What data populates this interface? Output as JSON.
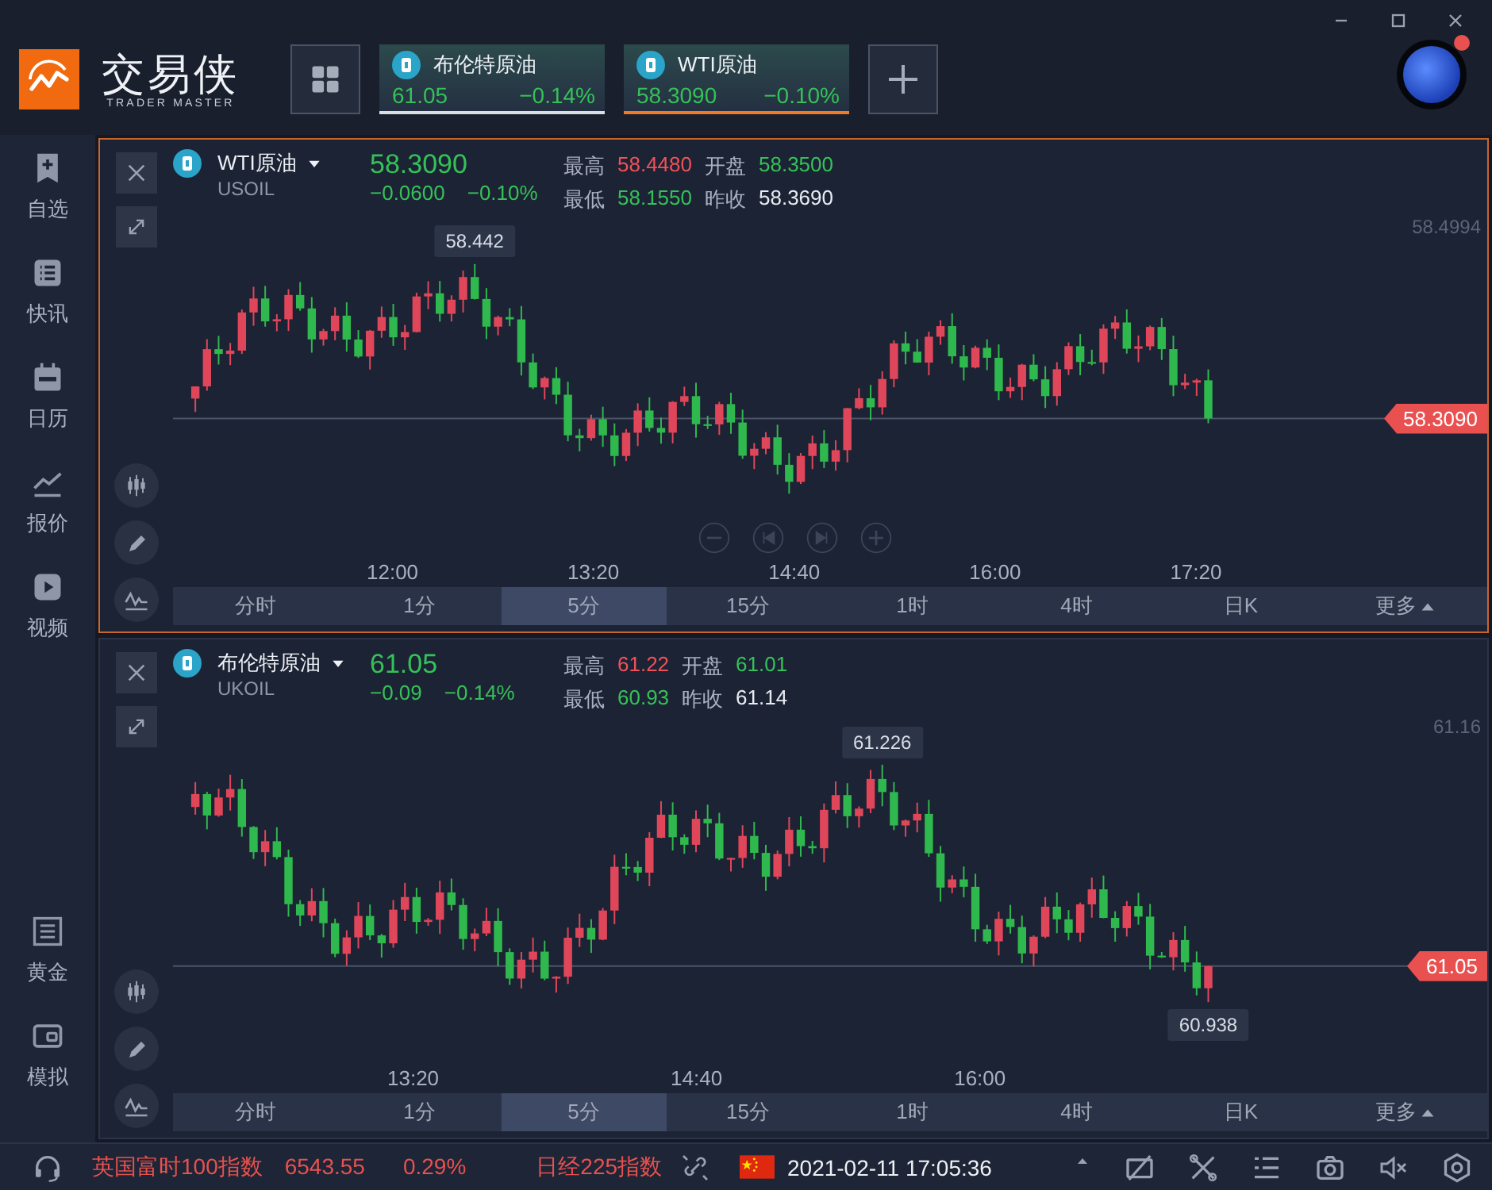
{
  "app": {
    "name": "交易侠",
    "tagline": "TRADER MASTER"
  },
  "quote_tabs": [
    {
      "name": "布伦特原油",
      "price": "61.05",
      "change": "−0.14%",
      "selected": false
    },
    {
      "name": "WTI原油",
      "price": "58.3090",
      "change": "−0.10%",
      "selected": true
    }
  ],
  "sidebar": {
    "items": [
      {
        "label": "自选"
      },
      {
        "label": "快讯"
      },
      {
        "label": "日历"
      },
      {
        "label": "报价"
      },
      {
        "label": "视频"
      }
    ],
    "bottom_items": [
      {
        "label": "黄金"
      },
      {
        "label": "模拟"
      }
    ]
  },
  "charts": [
    {
      "active": true,
      "name": "WTI原油",
      "symbol": "USOIL",
      "price": "58.3090",
      "change": "−0.0600",
      "change_pct": "−0.10%",
      "stats": [
        {
          "label": "最高",
          "value": "58.4480",
          "color": "#f25157"
        },
        {
          "label": "开盘",
          "value": "58.3500",
          "color": "#35c158"
        },
        {
          "label": "最低",
          "value": "58.1550",
          "color": "#35c158"
        },
        {
          "label": "昨收",
          "value": "58.3690",
          "color": "#e8ecf2"
        }
      ],
      "axis_label": "58.4994",
      "high_marker": "58.442",
      "last_tag": "58.3090",
      "times": [
        "12:00",
        "13:20",
        "14:40",
        "16:00",
        "17:20"
      ],
      "periods": [
        {
          "label": "分时",
          "selected": false
        },
        {
          "label": "1分",
          "selected": false
        },
        {
          "label": "5分",
          "selected": true
        },
        {
          "label": "15分",
          "selected": false
        },
        {
          "label": "1时",
          "selected": false
        },
        {
          "label": "4时",
          "selected": false
        },
        {
          "label": "日K",
          "selected": false
        },
        {
          "label": "更多",
          "selected": false
        }
      ]
    },
    {
      "active": false,
      "name": "布伦特原油",
      "symbol": "UKOIL",
      "price": "61.05",
      "change": "−0.09",
      "change_pct": "−0.14%",
      "stats": [
        {
          "label": "最高",
          "value": "61.22",
          "color": "#f25157"
        },
        {
          "label": "开盘",
          "value": "61.01",
          "color": "#35c158"
        },
        {
          "label": "最低",
          "value": "60.93",
          "color": "#35c158"
        },
        {
          "label": "昨收",
          "value": "61.14",
          "color": "#e8ecf2"
        }
      ],
      "axis_label": "61.16",
      "high_marker": "61.226",
      "low_marker": "60.938",
      "last_tag": "61.05",
      "times": [
        "13:20",
        "14:40",
        "16:00"
      ],
      "periods": [
        {
          "label": "分时",
          "selected": false
        },
        {
          "label": "1分",
          "selected": false
        },
        {
          "label": "5分",
          "selected": true
        },
        {
          "label": "15分",
          "selected": false
        },
        {
          "label": "1时",
          "selected": false
        },
        {
          "label": "4时",
          "selected": false
        },
        {
          "label": "日K",
          "selected": false
        },
        {
          "label": "更多",
          "selected": false
        }
      ]
    }
  ],
  "status_bar": {
    "ticker": [
      {
        "name": "英国富时100指数",
        "value": "6543.55",
        "change": "0.29%"
      },
      {
        "name": "日经225指数"
      }
    ],
    "clock": "2021-02-11 17:05:36"
  }
}
